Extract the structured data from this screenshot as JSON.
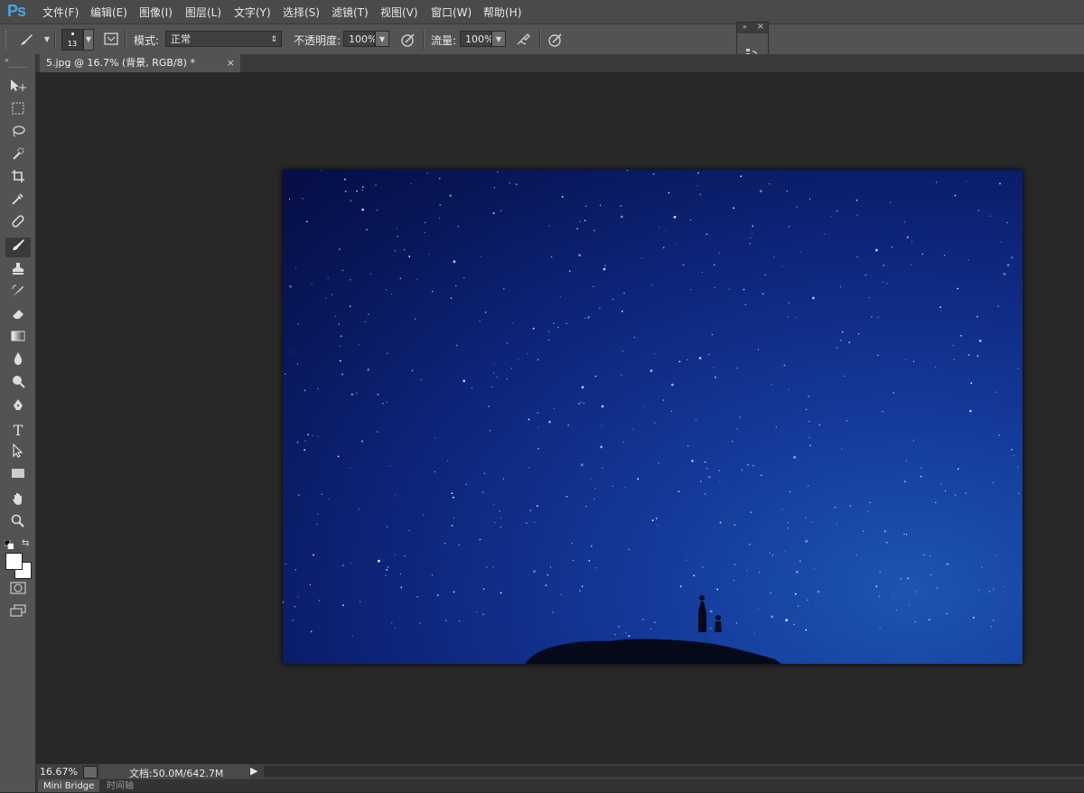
{
  "app": {
    "logo": "Ps"
  },
  "menu": [
    "文件(F)",
    "编辑(E)",
    "图像(I)",
    "图层(L)",
    "文字(Y)",
    "选择(S)",
    "滤镜(T)",
    "视图(V)",
    "窗口(W)",
    "帮助(H)"
  ],
  "options": {
    "brush_size": "13",
    "mode_label": "模式:",
    "mode_value": "正常",
    "opacity_label": "不透明度:",
    "opacity_value": "100%",
    "flow_label": "流量:",
    "flow_value": "100%"
  },
  "document": {
    "tab_title": "5.jpg @ 16.7% (背景, RGB/8) *",
    "close": "×"
  },
  "status": {
    "zoom": "16.67%",
    "doc_size": "文档:50.0M/642.7M"
  },
  "bottom_tabs": [
    "Mini Bridge",
    "时间轴"
  ],
  "tools": [
    "move-tool-icon",
    "marquee-tool-icon",
    "lasso-tool-icon",
    "quick-select-tool-icon",
    "crop-tool-icon",
    "eyedropper-tool-icon",
    "healing-brush-tool-icon",
    "brush-tool-icon",
    "clone-stamp-tool-icon",
    "history-brush-tool-icon",
    "eraser-tool-icon",
    "gradient-tool-icon",
    "blur-tool-icon",
    "dodge-tool-icon",
    "pen-tool-icon",
    "type-tool-icon",
    "path-select-tool-icon",
    "rectangle-tool-icon",
    "hand-tool-icon",
    "zoom-tool-icon"
  ],
  "colors": {
    "foreground": "#ffffff",
    "background": "#ffffff",
    "photo_sky": "#0d2478"
  }
}
